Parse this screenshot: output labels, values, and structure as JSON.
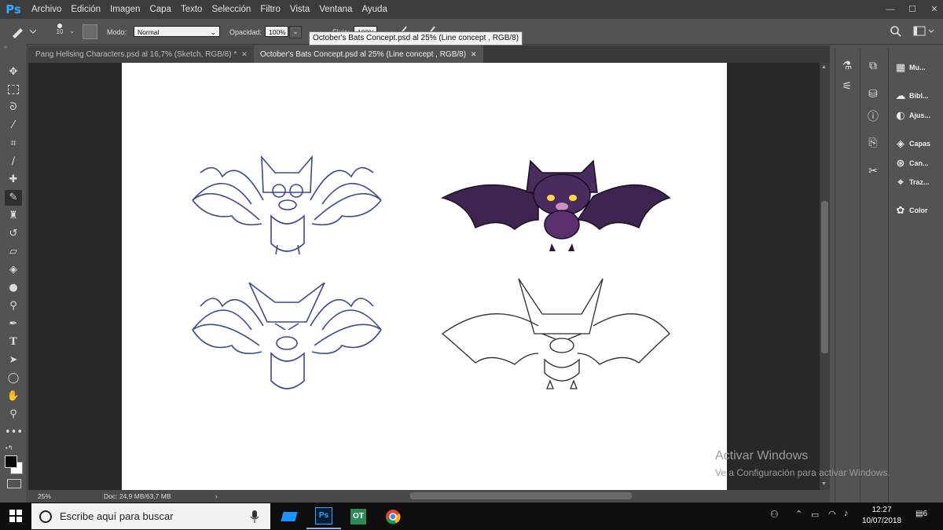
{
  "app": {
    "logo": "Ps"
  },
  "menu": [
    "Archivo",
    "Edición",
    "Imagen",
    "Capa",
    "Texto",
    "Selección",
    "Filtro",
    "Vista",
    "Ventana",
    "Ayuda"
  ],
  "window_controls": {
    "minimize": "—",
    "maximize": "☐",
    "close": "✕"
  },
  "options": {
    "brush_size": "10",
    "mode_label": "Modo:",
    "mode_value": "Normal",
    "opacity_label": "Opacidad:",
    "opacity_value": "100%",
    "flow_label": "Flujo:",
    "flow_value": "100%"
  },
  "tooltip": "October's Bats Concept.psd al 25% (Line concept , RGB/8)",
  "tabs": [
    {
      "label": "Pang Hellsing Characters.psd al 16,7% (Sketch, RGB/8) *",
      "active": false,
      "close": "✕"
    },
    {
      "label": "October's Bats Concept.psd al 25% (Line concept , RGB/8)",
      "active": true,
      "close": "✕"
    }
  ],
  "status": {
    "zoom": "25%",
    "doc": "Doc: 24,9 MB/63,7 MB",
    "arrow": "›"
  },
  "panels": [
    {
      "label": "Mu...",
      "icon": "grid-icon"
    },
    {
      "label": "Bibl...",
      "icon": "cloud-library-icon"
    },
    {
      "label": "Ajus...",
      "icon": "adjustments-icon"
    },
    {
      "label": "Capas",
      "icon": "layers-icon"
    },
    {
      "label": "Can...",
      "icon": "channels-icon"
    },
    {
      "label": "Traz...",
      "icon": "paths-icon"
    },
    {
      "label": "Color",
      "icon": "color-palette-icon"
    }
  ],
  "watermark": {
    "line1": "Activar Windows",
    "line2": "Ve a Configuración para activar Windows."
  },
  "taskbar": {
    "search_placeholder": "Escribe aquí para buscar",
    "time": "12:27",
    "date": "10/07/2018",
    "notifications": "6"
  },
  "colors": {
    "ps_blue": "#31a8ff",
    "bat_purple": "#3f2350",
    "sketch_blue": "#3b4a8c"
  }
}
